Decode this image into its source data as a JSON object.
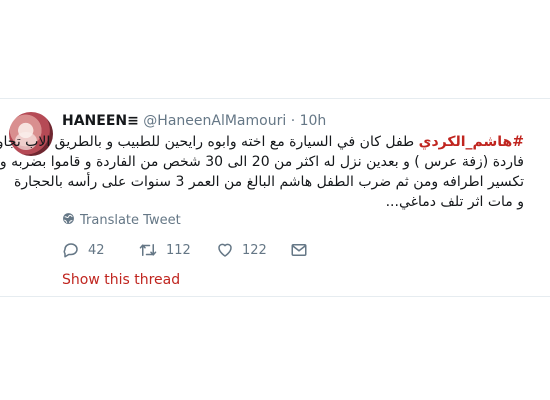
{
  "tweet": {
    "author_name": "HANEEN≡",
    "handle": "@HaneenAlMamouri",
    "separator": "·",
    "time": "10h",
    "hashtag": "#هاشم_الكردي",
    "text_line1": " طفل كان في السيارة مع اخته وابوه رايحين للطبيب و بالطريق الاب تجاوز",
    "text_line2": "فاردة (زفة عرس ) و بعدين نزل له اكثر من 20 الى 30 شخص من الفاردة و قاموا بضربه و",
    "text_line3": "تكسير اطرافه ومن ثم ضرب الطفل هاشم البالغ من العمر 3 سنوات على رأسه بالحجارة",
    "text_line4": "و مات اثر تلف دماغي...",
    "translate_label": "Translate Tweet",
    "replies": "42",
    "retweets": "112",
    "likes": "122",
    "show_thread": "Show this thread"
  },
  "colors": {
    "accent": "#c0251f",
    "muted": "#657786",
    "text": "#14171a",
    "divider": "#e6ecf0"
  },
  "icons": [
    "globe-icon",
    "reply-icon",
    "retweet-icon",
    "like-icon",
    "message-icon"
  ]
}
